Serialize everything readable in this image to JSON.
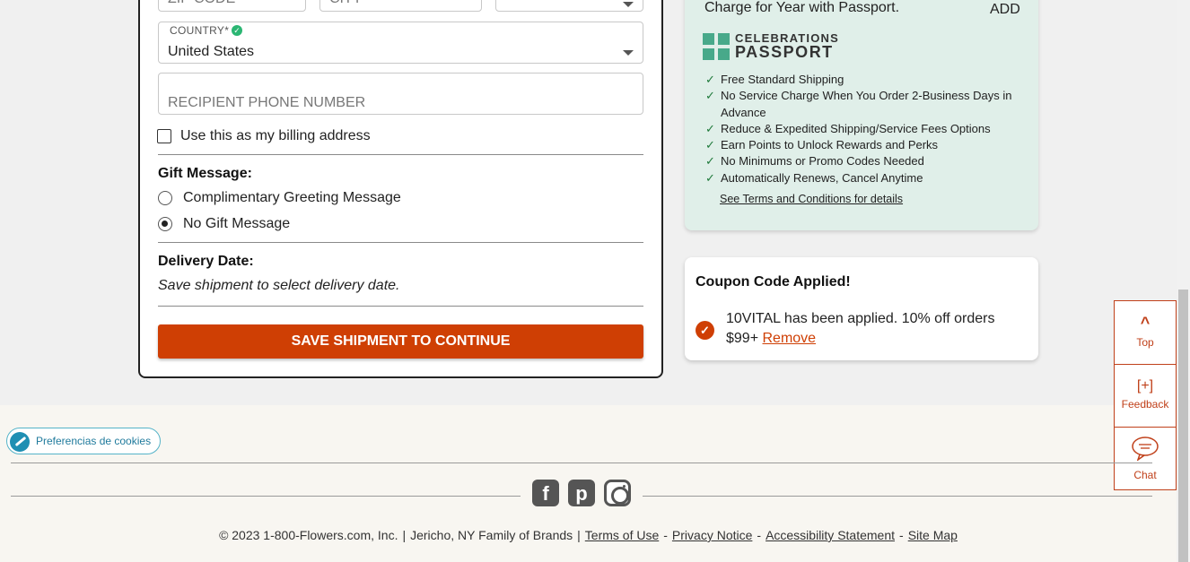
{
  "shipping_form": {
    "zip_placeholder": "ZIP CODE",
    "city_placeholder": "CITY",
    "country_label": "COUNTRY*",
    "country_value": "United States",
    "phone_placeholder": "RECIPIENT PHONE NUMBER",
    "billing_checkbox_label": "Use this as my billing address",
    "gift_message_title": "Gift Message:",
    "gift_options": [
      "Complimentary Greeting Message",
      "No Gift Message"
    ],
    "gift_selected": "No Gift Message",
    "delivery_title": "Delivery Date:",
    "delivery_note": "Save shipment to select delivery date.",
    "save_button": "SAVE SHIPMENT TO CONTINUE"
  },
  "passport": {
    "charge_text": "Charge for Year with Passport.",
    "add_label": "ADD",
    "logo_top": "CELEBRATIONS",
    "logo_bottom": "PASSPORT",
    "benefits": [
      "Free Standard Shipping",
      "No Service Charge When You Order 2-Business Days in Advance",
      "Reduce & Expedited Shipping/Service Fees Options",
      "Earn Points to Unlock Rewards and Perks",
      "No Minimums or Promo Codes Needed",
      "Automatically Renews, Cancel Anytime"
    ],
    "terms_link": "See Terms and Conditions for details"
  },
  "coupon": {
    "title": "Coupon Code Applied!",
    "message": "10VITAL has been applied. 10% off orders $99+",
    "remove_label": "Remove"
  },
  "side_tools": {
    "top_label": "Top",
    "feedback_label": "Feedback",
    "chat_label": "Chat",
    "feedback_icon": "[+]"
  },
  "footer": {
    "cookie_label": "Preferencias de cookies",
    "social": [
      "facebook-icon",
      "pinterest-icon",
      "instagram-icon"
    ],
    "copyright": "© 2023 1-800-Flowers.com, Inc.",
    "family": "Jericho, NY Family of Brands",
    "links": [
      "Terms of Use",
      "Privacy Notice",
      "Accessibility Statement",
      "Site Map"
    ]
  },
  "colors": {
    "accent": "#cf3f04",
    "passport_bg": "#e0efe9",
    "check_green": "#2bb673"
  }
}
